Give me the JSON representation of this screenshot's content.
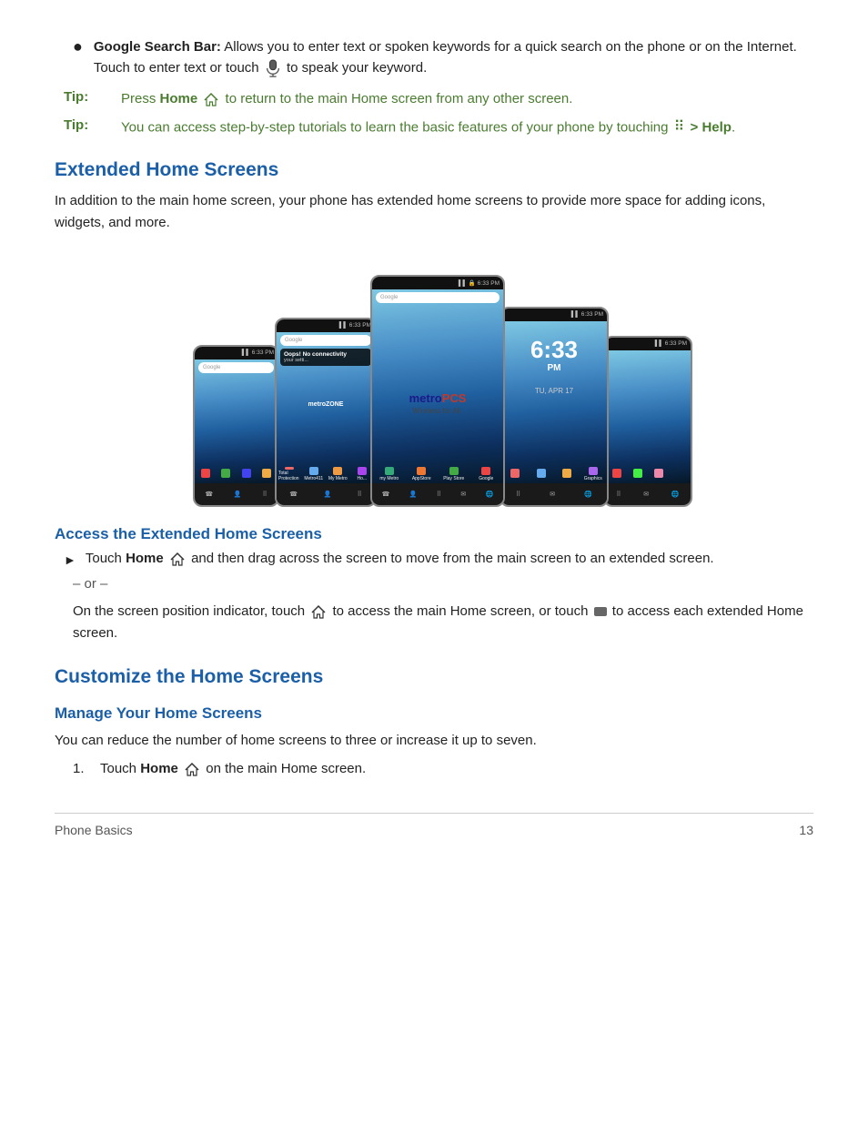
{
  "page": {
    "footer": {
      "section_label": "Phone Basics",
      "page_number": "13"
    }
  },
  "content": {
    "bullet_section": {
      "items": [
        {
          "label": "Google Search Bar:",
          "text": " Allows you to enter text or spoken keywords for a quick search on the phone or on the Internet. Touch to enter text or touch ",
          "text2": " to speak your keyword."
        }
      ]
    },
    "tips": [
      {
        "label": "Tip:",
        "text_prefix": "Press ",
        "bold": "Home",
        "text_suffix": " to return to the main Home screen from any other screen."
      },
      {
        "label": "Tip:",
        "text_prefix": "You can access step-by-step tutorials to learn the basic features of your phone by touching ",
        "bold": "> Help",
        "text_suffix": "."
      }
    ],
    "extended_home": {
      "heading": "Extended Home Screens",
      "body": "In addition to the main home screen, your phone has extended home screens to provide more space for adding icons, widgets, and more.",
      "access_heading": "Access the Extended Home Screens",
      "bullet1_prefix": "Touch ",
      "bullet1_bold": "Home",
      "bullet1_suffix": " and then drag across the screen to move from the main screen to an extended screen.",
      "or_text": "– or –",
      "indicator_text": "On the screen position indicator, touch ",
      "indicator_text2": " to access the main Home screen, or touch ",
      "indicator_text3": " to access each extended Home screen."
    },
    "customize": {
      "heading": "Customize the Home Screens",
      "manage_heading": "Manage Your Home Screens",
      "manage_body": "You can reduce the number of home screens to three or increase it up to seven.",
      "step1_prefix": "Touch ",
      "step1_bold": "Home",
      "step1_suffix": " on the main Home screen."
    },
    "screens": {
      "time": "6:33",
      "pm": "PM",
      "date": "TU, APR 17",
      "metro_text": "metro",
      "metro_pcs": "PCS",
      "wireless": "Wireless for All.",
      "google_label": "Google",
      "notification_title": "Oops! No connectivity",
      "notification_sub": "your setti..."
    }
  }
}
